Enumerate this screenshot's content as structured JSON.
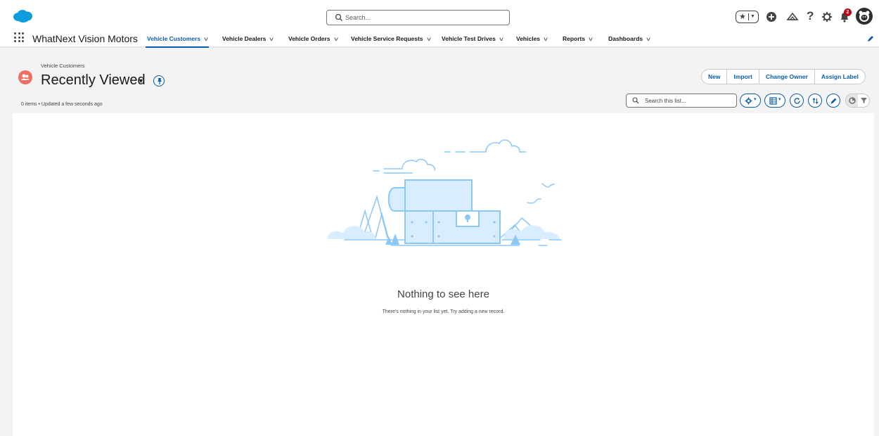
{
  "header": {
    "search_placeholder": "Search...",
    "notification_count": "2",
    "help_label": "?",
    "icons": [
      "salesforce-logo",
      "search-icon",
      "favorites-star-icon",
      "add-icon",
      "trailhead-icon",
      "help-icon",
      "setup-gear-icon",
      "notification-bell-icon",
      "user-avatar"
    ]
  },
  "nav": {
    "app_name": "WhatNext Vision Motors",
    "items": [
      {
        "label": "Vehicle Customers",
        "active": true
      },
      {
        "label": "Vehicle Dealers"
      },
      {
        "label": "Vehicle Orders"
      },
      {
        "label": "Vehicle Service Requests"
      },
      {
        "label": "Vehicle Test Drives"
      },
      {
        "label": "Vehicles"
      },
      {
        "label": "Reports"
      },
      {
        "label": "Dashboards"
      }
    ]
  },
  "list": {
    "object_label": "Vehicle Customers",
    "title": "Recently Viewed",
    "meta": "0 items • Updated a few seconds ago",
    "buttons": [
      "New",
      "Import",
      "Change Owner",
      "Assign Label"
    ],
    "search_placeholder": "Search this list..."
  },
  "empty_state": {
    "title": "Nothing to see here",
    "subtitle": "There's nothing in your list yet. Try adding a new record."
  },
  "colors": {
    "brand_blue": "#0b5cab",
    "object_icon": "#ef6e64",
    "salesforce_cloud": "#0d9dda",
    "page_bg": "#f3f3f3",
    "illustration_blue": "#8cc8f5",
    "illustration_fill": "#d8edff"
  }
}
